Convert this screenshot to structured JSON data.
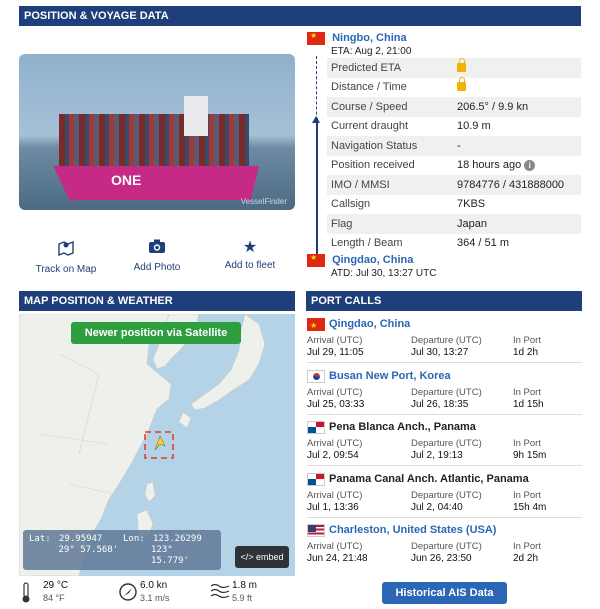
{
  "sections": {
    "position_voyage": "POSITION & VOYAGE DATA",
    "map_weather": "MAP POSITION & WEATHER",
    "port_calls": "PORT CALLS"
  },
  "photo": {
    "hull_text": "ONE",
    "watermark": "VesselFinder",
    "actions": [
      {
        "icon": "map-pin-icon",
        "label": "Track on Map"
      },
      {
        "icon": "camera-icon",
        "label": "Add Photo"
      },
      {
        "icon": "star-icon",
        "label": "Add to fleet"
      }
    ]
  },
  "voyage": {
    "destination": {
      "name": "Ningbo, China",
      "eta": "ETA: Aug 2, 21:00"
    },
    "origin": {
      "name": "Qingdao, China",
      "atd": "ATD: Jul 30, 13:27 UTC"
    },
    "rows": [
      {
        "label": "Predicted ETA",
        "value": "",
        "locked": true
      },
      {
        "label": "Distance / Time",
        "value": "",
        "locked": true
      },
      {
        "label": "Course / Speed",
        "value": "206.5° / 9.9 kn"
      },
      {
        "label": "Current draught",
        "value": "10.9 m"
      },
      {
        "label": "Navigation Status",
        "value": "-"
      },
      {
        "label": "Position received",
        "value": "18 hours ago",
        "info": true
      },
      {
        "label": "IMO / MMSI",
        "value": "9784776 / 431888000"
      },
      {
        "label": "Callsign",
        "value": "7KBS"
      },
      {
        "label": "Flag",
        "value": "Japan"
      },
      {
        "label": "Length / Beam",
        "value": "364 / 51 m"
      }
    ]
  },
  "map": {
    "satellite_button": "Newer position via Satellite",
    "lat_label": "Lat:",
    "lat_decimal": "29.95947",
    "lat_dms": "29° 57.568'",
    "lon_label": "Lon:",
    "lon_decimal": "123.26299",
    "lon_dms": "123° 15.779'",
    "embed_label": "</> embed"
  },
  "weather": {
    "temp_c": "29 °C",
    "temp_f": "84 °F",
    "wind_kn": "6.0 kn",
    "wind_ms": "3.1 m/s",
    "wave_m": "1.8 m",
    "wave_ft": "5.9 ft"
  },
  "port_calls": {
    "arrival_label": "Arrival (UTC)",
    "departure_label": "Departure (UTC)",
    "inport_label": "In Port",
    "items": [
      {
        "flag": "cn",
        "name": "Qingdao, China",
        "link": true,
        "arrival": "Jul 29, 11:05",
        "departure": "Jul 30, 13:27",
        "in_port": "1d 2h"
      },
      {
        "flag": "kr",
        "name": "Busan New Port, Korea",
        "link": true,
        "arrival": "Jul 25, 03:33",
        "departure": "Jul 26, 18:35",
        "in_port": "1d 15h"
      },
      {
        "flag": "pa",
        "name": "Pena Blanca Anch., Panama",
        "link": false,
        "arrival": "Jul 2, 09:54",
        "departure": "Jul 2, 19:13",
        "in_port": "9h 15m"
      },
      {
        "flag": "pa",
        "name": "Panama Canal Anch. Atlantic, Panama",
        "link": false,
        "arrival": "Jul 1, 13:36",
        "departure": "Jul 2, 04:40",
        "in_port": "15h 4m"
      },
      {
        "flag": "us",
        "name": "Charleston, United States (USA)",
        "link": true,
        "arrival": "Jun 24, 21:48",
        "departure": "Jun 26, 23:50",
        "in_port": "2d 2h"
      }
    ],
    "historical_button": "Historical AIS Data"
  }
}
